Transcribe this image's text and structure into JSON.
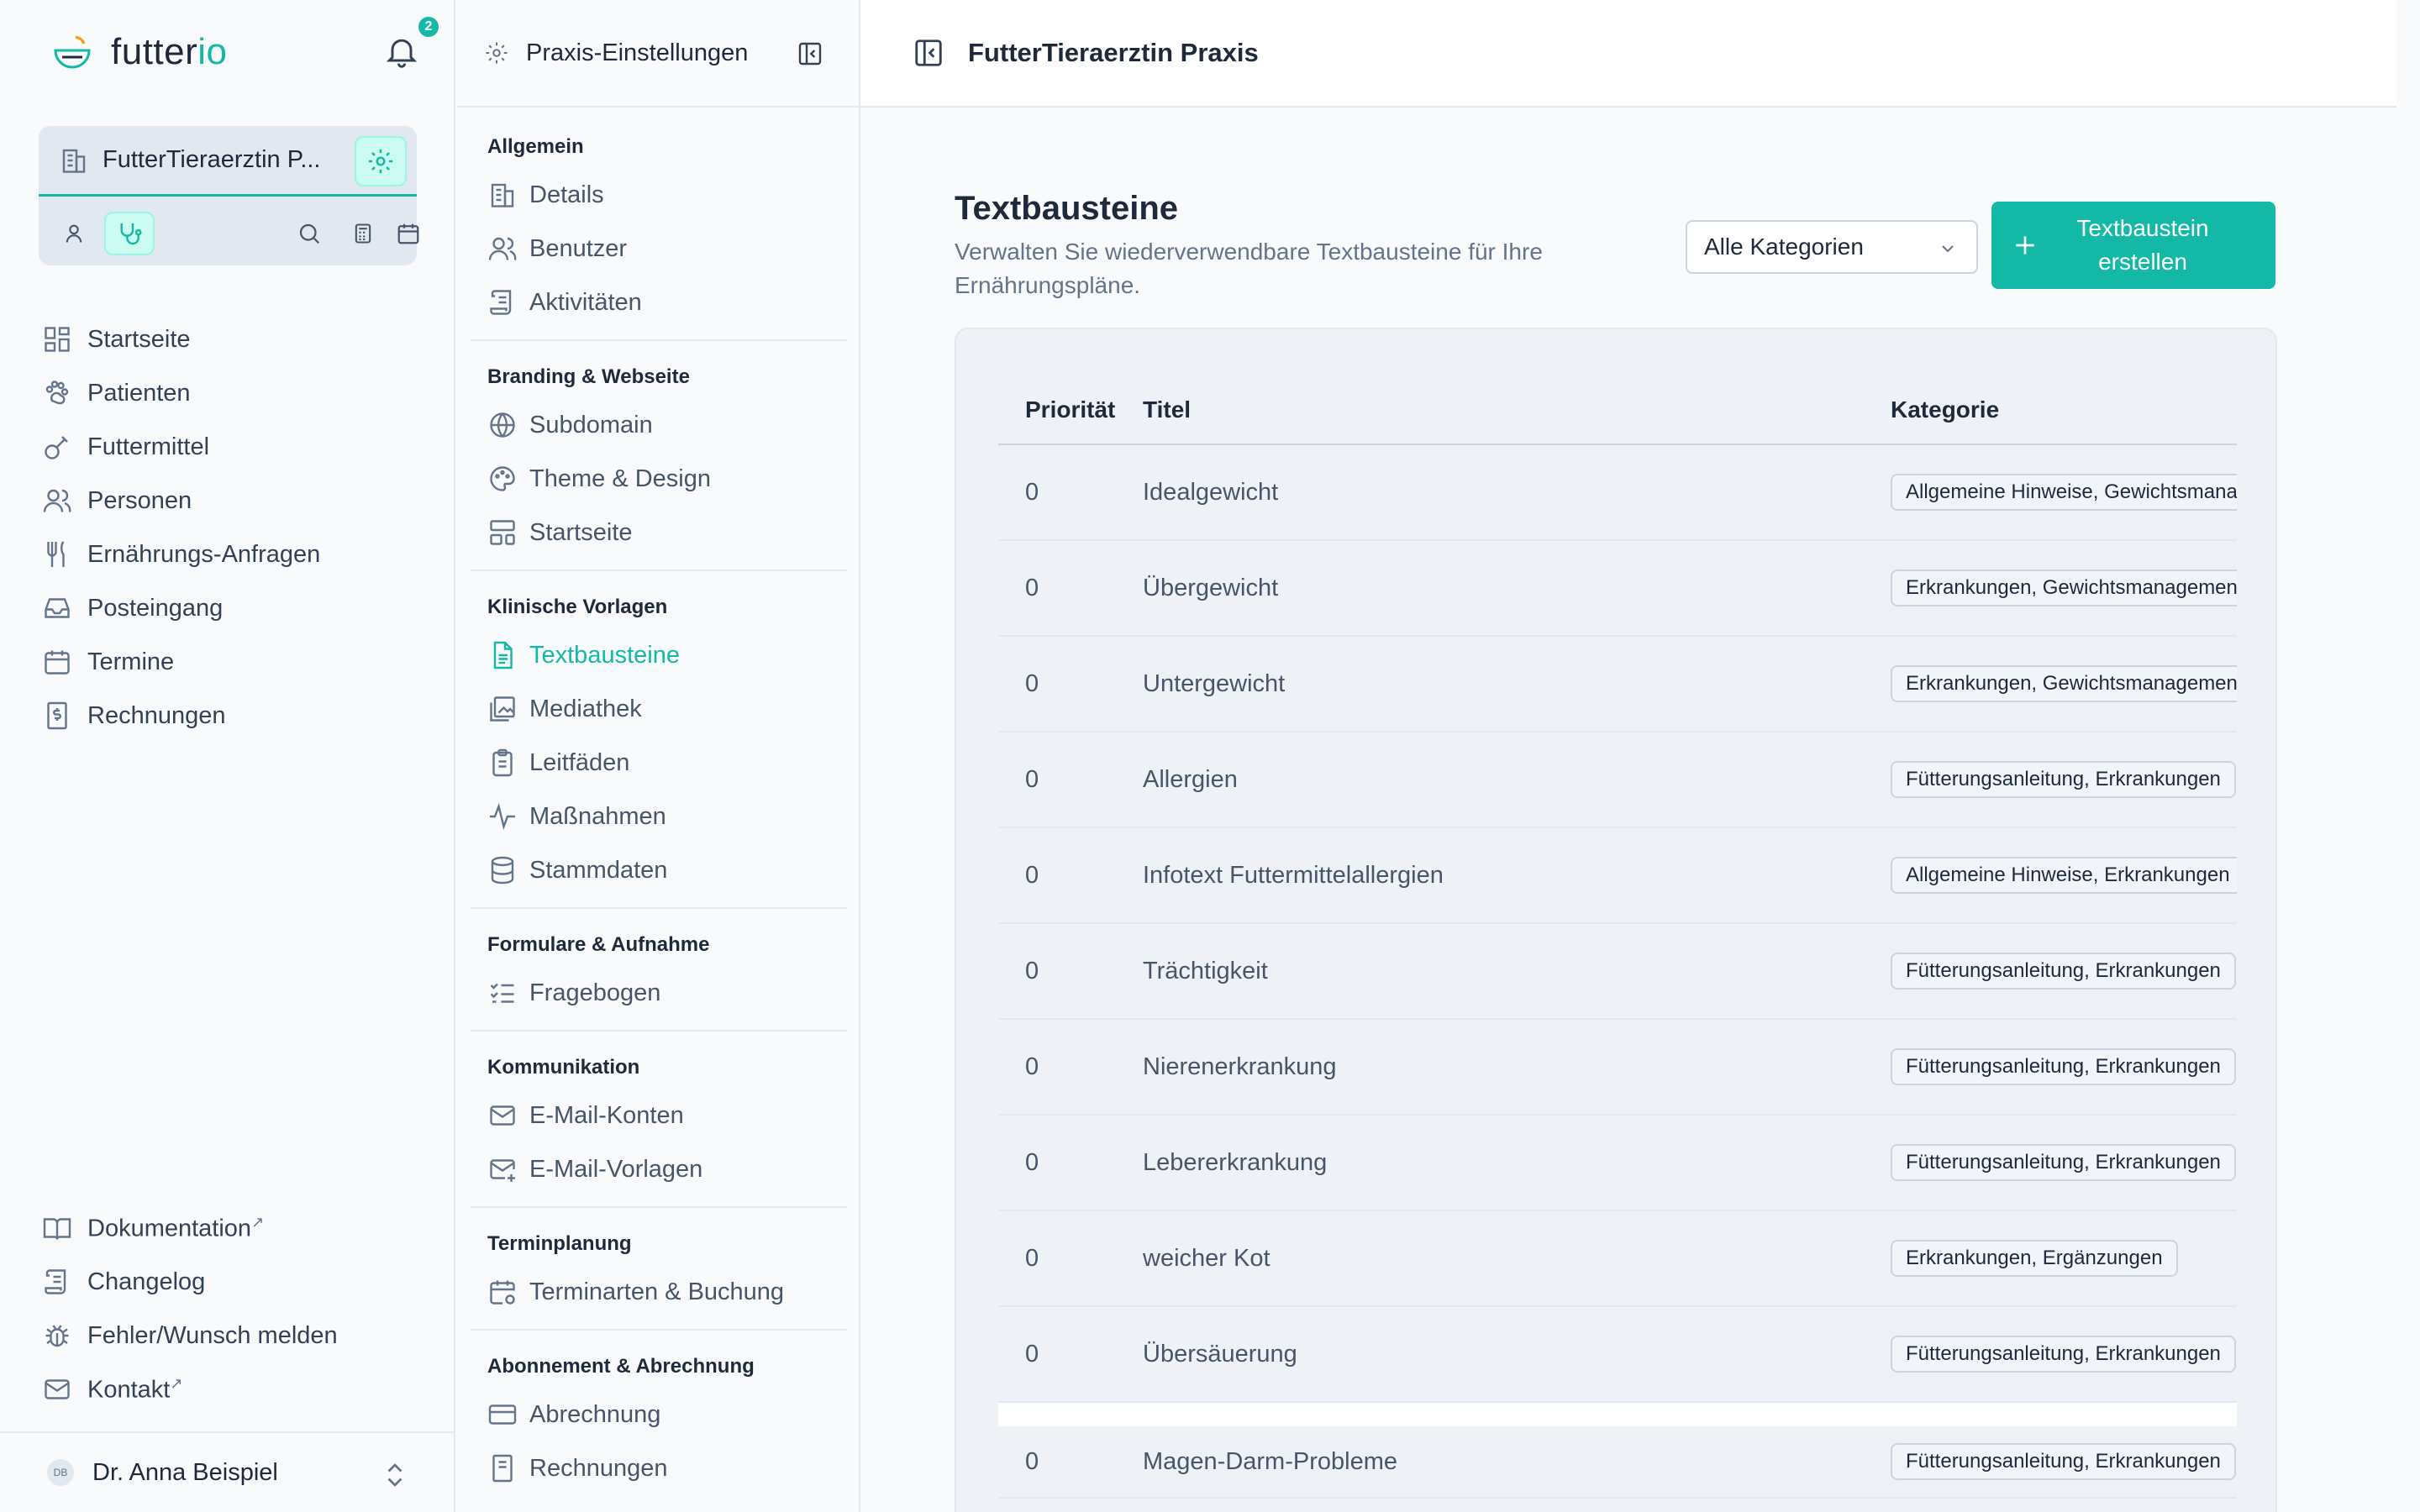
{
  "app": {
    "logo_text": "futter",
    "logo_text_accent": "io",
    "notification_count": "2"
  },
  "clinic": {
    "name": "FutterTieraerztin P..."
  },
  "nav": [
    {
      "label": "Startseite",
      "icon": "dashboard-icon"
    },
    {
      "label": "Patienten",
      "icon": "paw-icon"
    },
    {
      "label": "Futtermittel",
      "icon": "food-icon"
    },
    {
      "label": "Personen",
      "icon": "users-icon"
    },
    {
      "label": "Ernährungs-Anfragen",
      "icon": "utensils-icon"
    },
    {
      "label": "Posteingang",
      "icon": "inbox-icon"
    },
    {
      "label": "Termine",
      "icon": "calendar-icon"
    },
    {
      "label": "Rechnungen",
      "icon": "invoice-icon"
    }
  ],
  "nav_bottom": [
    {
      "label": "Dokumentation",
      "icon": "book-icon",
      "external": "↗"
    },
    {
      "label": "Changelog",
      "icon": "scroll-icon",
      "external": ""
    },
    {
      "label": "Fehler/Wunsch melden",
      "icon": "bug-icon",
      "external": ""
    },
    {
      "label": "Kontakt",
      "icon": "mail-icon",
      "external": "↗"
    }
  ],
  "user": {
    "initials": "DB",
    "name": "Dr. Anna Beispiel"
  },
  "settings": {
    "title": "Praxis-Einstellungen",
    "sections": [
      {
        "title": "Allgemein",
        "items": [
          "Details",
          "Benutzer",
          "Aktivitäten"
        ]
      },
      {
        "title": "Branding & Webseite",
        "items": [
          "Subdomain",
          "Theme & Design",
          "Startseite"
        ]
      },
      {
        "title": "Klinische Vorlagen",
        "items": [
          "Textbausteine",
          "Mediathek",
          "Leitfäden",
          "Maßnahmen",
          "Stammdaten"
        ]
      },
      {
        "title": "Formulare & Aufnahme",
        "items": [
          "Fragebogen"
        ]
      },
      {
        "title": "Kommunikation",
        "items": [
          "E-Mail-Konten",
          "E-Mail-Vorlagen"
        ]
      },
      {
        "title": "Terminplanung",
        "items": [
          "Terminarten & Buchung"
        ]
      },
      {
        "title": "Abonnement & Abrechnung",
        "items": [
          "Abrechnung",
          "Rechnungen"
        ]
      }
    ],
    "active": "Textbausteine"
  },
  "main": {
    "header_title": "FutterTieraerztin Praxis",
    "page_title": "Textbausteine",
    "page_subtitle": "Verwalten Sie wiederverwendbare Textbausteine für Ihre Ernährungspläne.",
    "category_select": "Alle Kategorien",
    "create_button": "Textbaustein erstellen",
    "columns": {
      "priority": "Priorität",
      "title": "Titel",
      "category": "Kategorie"
    },
    "rows": [
      {
        "priority": "0",
        "title": "Idealgewicht",
        "category": "Allgemeine Hinweise, Gewichtsmanagement"
      },
      {
        "priority": "0",
        "title": "Übergewicht",
        "category": "Erkrankungen, Gewichtsmanagement"
      },
      {
        "priority": "0",
        "title": "Untergewicht",
        "category": "Erkrankungen, Gewichtsmanagement"
      },
      {
        "priority": "0",
        "title": "Allergien",
        "category": "Fütterungsanleitung, Erkrankungen"
      },
      {
        "priority": "0",
        "title": "Infotext Futtermittelallergien",
        "category": "Allgemeine Hinweise, Erkrankungen"
      },
      {
        "priority": "0",
        "title": "Trächtigkeit",
        "category": "Fütterungsanleitung, Erkrankungen"
      },
      {
        "priority": "0",
        "title": "Nierenerkrankung",
        "category": "Fütterungsanleitung, Erkrankungen"
      },
      {
        "priority": "0",
        "title": "Lebererkrankung",
        "category": "Fütterungsanleitung, Erkrankungen"
      },
      {
        "priority": "0",
        "title": "weicher Kot",
        "category": "Erkrankungen, Ergänzungen"
      },
      {
        "priority": "0",
        "title": "Übersäuerung",
        "category": "Fütterungsanleitung, Erkrankungen"
      },
      {
        "priority": "0",
        "title": "Magen-Darm-Probleme",
        "category": "Fütterungsanleitung, Erkrankungen"
      }
    ]
  },
  "colors": {
    "accent": "#14b8a6",
    "accent_light": "#ccfbf1"
  }
}
